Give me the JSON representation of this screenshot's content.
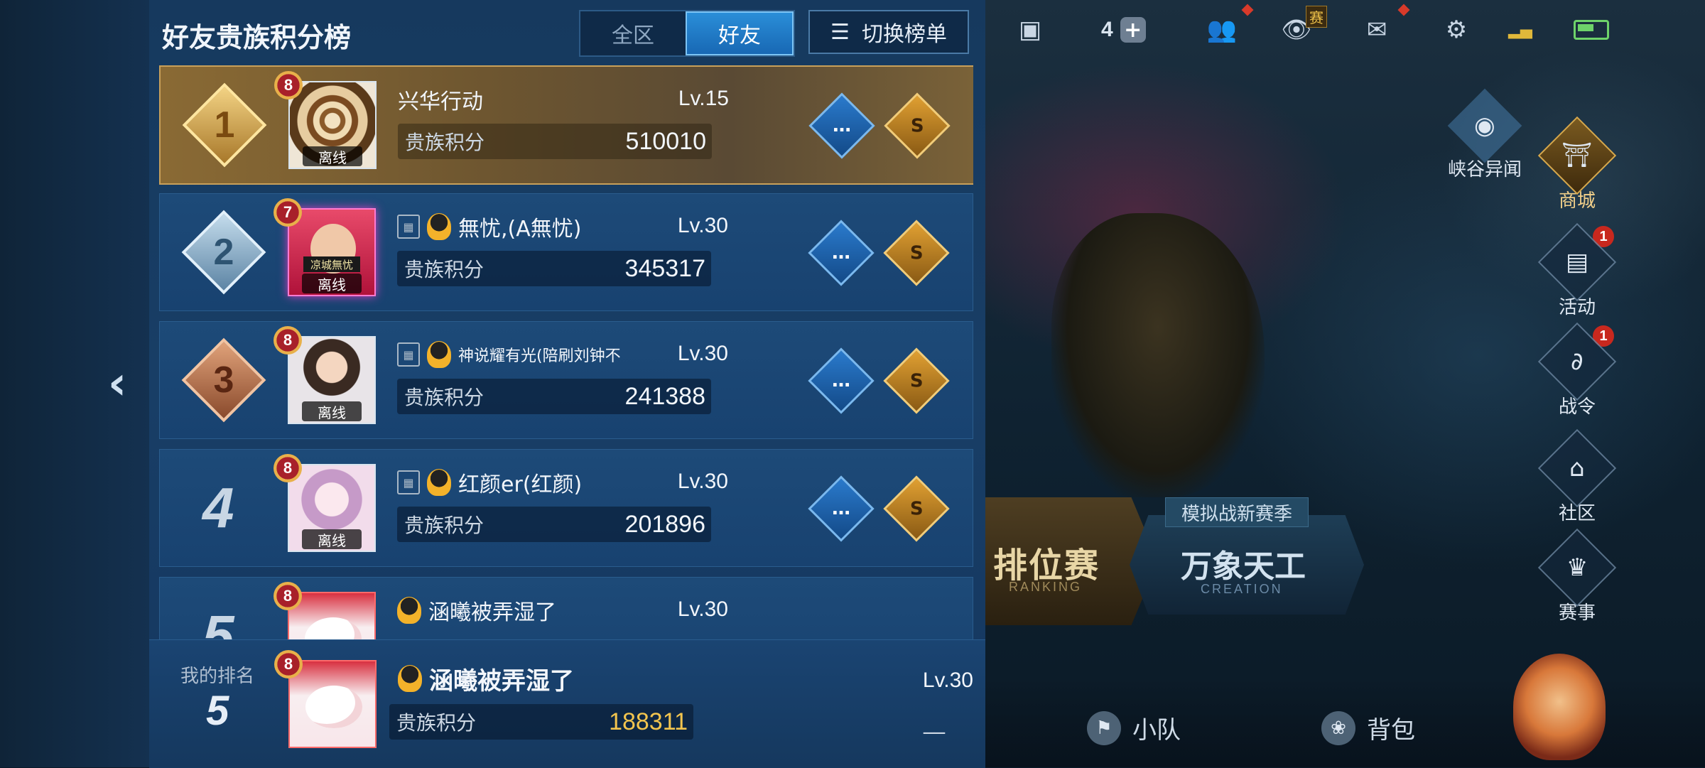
{
  "panel": {
    "title": "好友贵族积分榜",
    "tabs": [
      {
        "label": "全区",
        "active": false
      },
      {
        "label": "好友",
        "active": true
      }
    ],
    "switch_label": "切换榜单"
  },
  "entries": [
    {
      "rank": "1",
      "name": "兴华行动",
      "level": "Lv.15",
      "score_label": "贵族积分",
      "score": "510010",
      "status": "离线",
      "noble_level": "8"
    },
    {
      "rank": "2",
      "name": "無忧,(A無忧)",
      "level": "Lv.30",
      "score_label": "贵族积分",
      "score": "345317",
      "status": "离线",
      "noble_level": "7",
      "frame_tag": "凉城無忧"
    },
    {
      "rank": "3",
      "name": "神说耀有光(陪刷刘钟不",
      "level": "Lv.30",
      "score_label": "贵族积分",
      "score": "241388",
      "status": "离线",
      "noble_level": "8"
    },
    {
      "rank": "4",
      "name": "红颜er(红颜)",
      "level": "Lv.30",
      "score_label": "贵族积分",
      "score": "201896",
      "status": "离线",
      "noble_level": "8"
    },
    {
      "rank": "5",
      "name": "涵曦被弄湿了",
      "level": "Lv.30",
      "noble_level": "8"
    }
  ],
  "my_rank": {
    "label": "我的排名",
    "rank": "5",
    "name": "涵曦被弄湿了",
    "level": "Lv.30",
    "score_label": "贵族积分",
    "score": "188311",
    "trend": "__",
    "noble_level": "8"
  },
  "game": {
    "topbar": {
      "friend_count": "4",
      "sai_badge": "赛"
    },
    "side_menu": [
      {
        "label": "峡谷异闻",
        "icon": "map-icon"
      },
      {
        "label": "商城",
        "icon": "shop-icon"
      },
      {
        "label": "活动",
        "icon": "chest-icon",
        "badge": "1"
      },
      {
        "label": "战令",
        "icon": "dragon-icon",
        "badge": "1"
      },
      {
        "label": "社区",
        "icon": "pavilion-icon"
      },
      {
        "label": "赛事",
        "icon": "trophy-icon"
      }
    ],
    "modes": {
      "ranking": {
        "label": "排位赛",
        "sub": "RANKING"
      },
      "creation_tag": "模拟战新赛季",
      "creation": {
        "label": "万象天工",
        "sub": "CREATION"
      }
    },
    "bottombar": [
      {
        "label": "小队",
        "icon": "flag-icon"
      },
      {
        "label": "背包",
        "icon": "bag-icon"
      }
    ]
  },
  "colors": {
    "accent": "#1868b4",
    "gold": "#f2c44e",
    "panel": "#183e66"
  }
}
